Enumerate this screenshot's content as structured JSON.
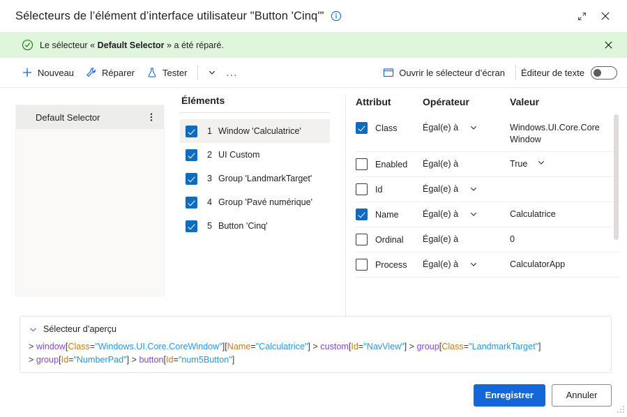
{
  "window": {
    "title": "Sélecteurs de l’élément d’interface utilisateur \"Button 'Cinq'\"",
    "info_icon": "info-icon",
    "restore_icon": "restore-icon",
    "close_icon": "close-icon"
  },
  "notification": {
    "icon": "check-circle-icon",
    "text_before": "Le sélecteur « ",
    "text_bold": "Default Selector",
    "text_after": " » a été réparé.",
    "close_icon": "close-icon",
    "background": "#dff6dd",
    "accent": "#107c10"
  },
  "toolbar": {
    "new_label": "Nouveau",
    "repair_label": "Réparer",
    "test_label": "Tester",
    "overflow_label": "…",
    "screen_selector_label": "Ouvrir le sélecteur d’écran",
    "text_editor_label": "Éditeur de texte",
    "text_editor_on": false,
    "accent": "#0f6cbd"
  },
  "selectors_panel": {
    "items": [
      {
        "label": "Default Selector",
        "selected": true,
        "more_icon": "more-vertical-icon"
      }
    ]
  },
  "elements": {
    "title": "Éléments",
    "rows": [
      {
        "index": "1",
        "label": "Window 'Calculatrice'",
        "checked": true,
        "selected": true
      },
      {
        "index": "2",
        "label": "UI Custom",
        "checked": true,
        "selected": false
      },
      {
        "index": "3",
        "label": "Group 'LandmarkTarget'",
        "checked": true,
        "selected": false
      },
      {
        "index": "4",
        "label": "Group 'Pavé numérique'",
        "checked": true,
        "selected": false
      },
      {
        "index": "5",
        "label": "Button 'Cinq'",
        "checked": true,
        "selected": false
      }
    ]
  },
  "attributes": {
    "headers": {
      "attribute": "Attribut",
      "operator": "Opérateur",
      "value": "Valeur"
    },
    "rows": [
      {
        "checked": true,
        "name": "Class",
        "operator": "Égal(e) à",
        "value": "Windows.UI.Core.CoreWindow",
        "has_op_caret": true,
        "has_value_caret": false
      },
      {
        "checked": false,
        "name": "Enabled",
        "operator": "Égal(e) à",
        "value": "True",
        "has_op_caret": false,
        "has_value_caret": true
      },
      {
        "checked": false,
        "name": "Id",
        "operator": "Égal(e) à",
        "value": "",
        "has_op_caret": true,
        "has_value_caret": false
      },
      {
        "checked": true,
        "name": "Name",
        "operator": "Égal(e) à",
        "value": "Calculatrice",
        "has_op_caret": true,
        "has_value_caret": false
      },
      {
        "checked": false,
        "name": "Ordinal",
        "operator": "Égal(e) à",
        "value": "0",
        "has_op_caret": false,
        "has_value_caret": false
      },
      {
        "checked": false,
        "name": "Process",
        "operator": "Égal(e) à",
        "value": "CalculatorApp",
        "has_op_caret": true,
        "has_value_caret": false
      }
    ]
  },
  "preview": {
    "title": "Sélecteur d’aperçu",
    "caret_icon": "chevron-down-icon",
    "tokens": [
      {
        "t": "gt",
        "s": ">"
      },
      {
        "t": "sp",
        "s": " "
      },
      {
        "t": "tag",
        "s": "window"
      },
      {
        "t": "brk",
        "s": "["
      },
      {
        "t": "attr",
        "s": "Class"
      },
      {
        "t": "eq",
        "s": "="
      },
      {
        "t": "str",
        "s": "\"Windows.UI.Core.CoreWindow\""
      },
      {
        "t": "brk",
        "s": "]"
      },
      {
        "t": "brk",
        "s": "["
      },
      {
        "t": "attr",
        "s": "Name"
      },
      {
        "t": "eq",
        "s": "="
      },
      {
        "t": "str",
        "s": "\"Calculatrice\""
      },
      {
        "t": "brk",
        "s": "]"
      },
      {
        "t": "sp",
        "s": " "
      },
      {
        "t": "gt",
        "s": ">"
      },
      {
        "t": "sp",
        "s": " "
      },
      {
        "t": "tag",
        "s": "custom"
      },
      {
        "t": "brk",
        "s": "["
      },
      {
        "t": "attr",
        "s": "Id"
      },
      {
        "t": "eq",
        "s": "="
      },
      {
        "t": "str",
        "s": "\"NavView\""
      },
      {
        "t": "brk",
        "s": "]"
      },
      {
        "t": "sp",
        "s": " "
      },
      {
        "t": "gt",
        "s": ">"
      },
      {
        "t": "sp",
        "s": " "
      },
      {
        "t": "tag",
        "s": "group"
      },
      {
        "t": "brk",
        "s": "["
      },
      {
        "t": "attr",
        "s": "Class"
      },
      {
        "t": "eq",
        "s": "="
      },
      {
        "t": "str",
        "s": "\"LandmarkTarget\""
      },
      {
        "t": "brk",
        "s": "]"
      },
      {
        "t": "br",
        "s": ""
      },
      {
        "t": "gt",
        "s": ">"
      },
      {
        "t": "sp",
        "s": " "
      },
      {
        "t": "tag",
        "s": "group"
      },
      {
        "t": "brk",
        "s": "["
      },
      {
        "t": "attr",
        "s": "Id"
      },
      {
        "t": "eq",
        "s": "="
      },
      {
        "t": "str",
        "s": "\"NumberPad\""
      },
      {
        "t": "brk",
        "s": "]"
      },
      {
        "t": "sp",
        "s": " "
      },
      {
        "t": "gt",
        "s": ">"
      },
      {
        "t": "sp",
        "s": " "
      },
      {
        "t": "tag",
        "s": "button"
      },
      {
        "t": "brk",
        "s": "["
      },
      {
        "t": "attr",
        "s": "Id"
      },
      {
        "t": "eq",
        "s": "="
      },
      {
        "t": "str",
        "s": "\"num5Button\""
      },
      {
        "t": "brk",
        "s": "]"
      }
    ]
  },
  "footer": {
    "save_label": "Enregistrer",
    "cancel_label": "Annuler",
    "primary_color": "#1268d8"
  }
}
